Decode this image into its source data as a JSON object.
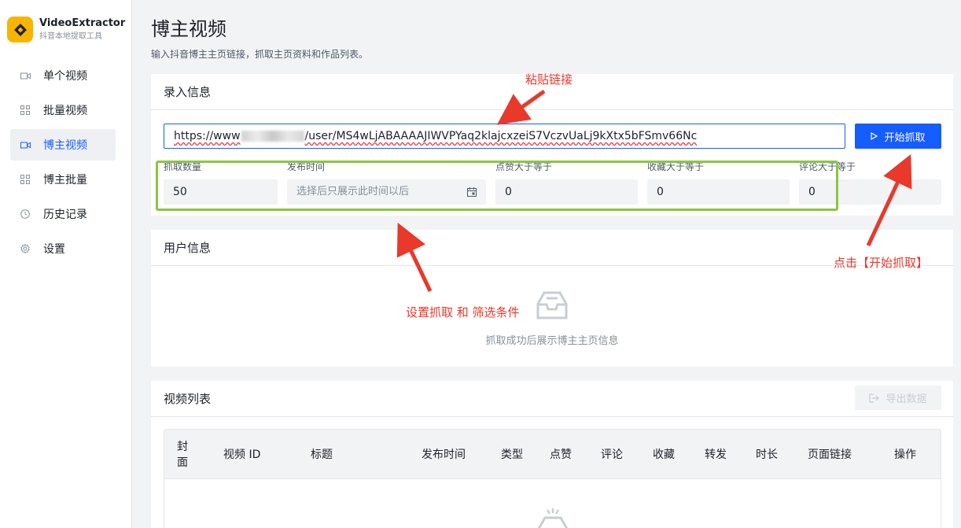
{
  "app": {
    "name": "VideoExtractor",
    "subtitle": "抖音本地提取工具"
  },
  "sidebar": {
    "items": [
      {
        "label": "单个视频",
        "icon": "video-icon",
        "active": false
      },
      {
        "label": "批量视频",
        "icon": "grid-icon",
        "active": false
      },
      {
        "label": "博主视频",
        "icon": "video-icon",
        "active": true
      },
      {
        "label": "博主批量",
        "icon": "grid-icon",
        "active": false
      },
      {
        "label": "历史记录",
        "icon": "clock-icon",
        "active": false
      },
      {
        "label": "设置",
        "icon": "gear-icon",
        "active": false
      }
    ]
  },
  "page": {
    "title": "博主视频",
    "subtitle": "输入抖音博主主页链接，抓取主页资料和作品列表。"
  },
  "input_card": {
    "title": "录入信息",
    "url_prefix": "https://www",
    "url_suffix": "/user/MS4wLjABAAAAJIWVPYaq2klajcxzeiS7VczvUaLj9kXtx5bFSmv66Nc",
    "start_button": "开始抓取",
    "fields": {
      "count": {
        "label": "抓取数量",
        "value": "50"
      },
      "publish_time": {
        "label": "发布时间",
        "placeholder": "选择后只展示此时间以后"
      },
      "likes": {
        "label": "点赞大于等于",
        "value": "0"
      },
      "favorites": {
        "label": "收藏大于等于",
        "value": "0"
      },
      "comments": {
        "label": "评论大于等于",
        "value": "0"
      }
    }
  },
  "user_card": {
    "title": "用户信息",
    "empty_text": "抓取成功后展示博主主页信息"
  },
  "video_card": {
    "title": "视频列表",
    "export_button": "导出数据",
    "columns": [
      "封\n面",
      "视频 ID",
      "标题",
      "发布时间",
      "类型",
      "点赞",
      "评论",
      "收藏",
      "转发",
      "时长",
      "页面链接",
      "操作"
    ]
  },
  "annotations": {
    "paste_link": "粘贴链接",
    "click_start": "点击【开始抓取】",
    "set_filters": "设置抓取 和 筛选条件"
  },
  "colors": {
    "primary": "#165dff",
    "logo": "#f7b500",
    "annotation": "#e8392b",
    "highlight_box": "#8cc63f"
  }
}
